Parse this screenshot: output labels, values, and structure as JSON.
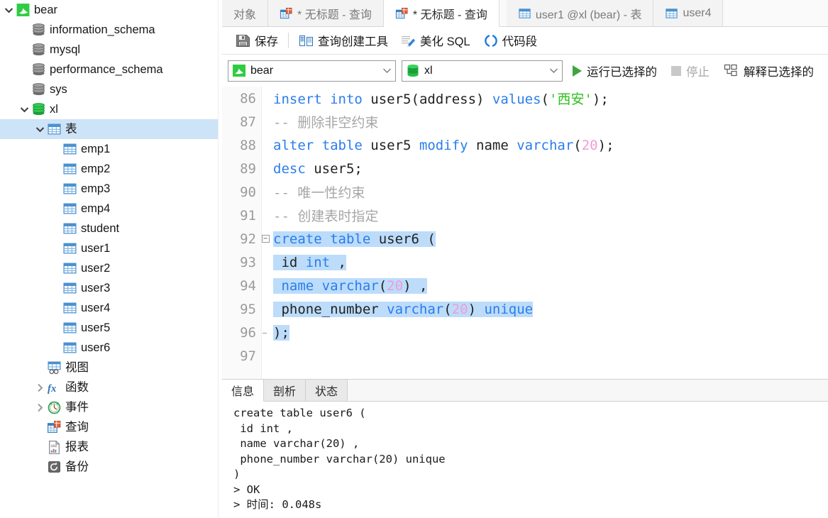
{
  "sidebar": {
    "items": [
      {
        "label": "bear",
        "icon": "navicat-connection-icon",
        "depth": 0,
        "twisty": "down",
        "selected": false
      },
      {
        "label": "information_schema",
        "icon": "database-gray-icon",
        "depth": 1,
        "twisty": "none",
        "selected": false
      },
      {
        "label": "mysql",
        "icon": "database-gray-icon",
        "depth": 1,
        "twisty": "none",
        "selected": false
      },
      {
        "label": "performance_schema",
        "icon": "database-gray-icon",
        "depth": 1,
        "twisty": "none",
        "selected": false
      },
      {
        "label": "sys",
        "icon": "database-gray-icon",
        "depth": 1,
        "twisty": "none",
        "selected": false
      },
      {
        "label": "xl",
        "icon": "database-green-icon",
        "depth": 1,
        "twisty": "down",
        "selected": false
      },
      {
        "label": "表",
        "icon": "table-folder-icon",
        "depth": 2,
        "twisty": "down",
        "selected": true
      },
      {
        "label": "emp1",
        "icon": "table-icon",
        "depth": 3,
        "twisty": "none",
        "selected": false
      },
      {
        "label": "emp2",
        "icon": "table-icon",
        "depth": 3,
        "twisty": "none",
        "selected": false
      },
      {
        "label": "emp3",
        "icon": "table-icon",
        "depth": 3,
        "twisty": "none",
        "selected": false
      },
      {
        "label": "emp4",
        "icon": "table-icon",
        "depth": 3,
        "twisty": "none",
        "selected": false
      },
      {
        "label": "student",
        "icon": "table-icon",
        "depth": 3,
        "twisty": "none",
        "selected": false
      },
      {
        "label": "user1",
        "icon": "table-icon",
        "depth": 3,
        "twisty": "none",
        "selected": false
      },
      {
        "label": "user2",
        "icon": "table-icon",
        "depth": 3,
        "twisty": "none",
        "selected": false
      },
      {
        "label": "user3",
        "icon": "table-icon",
        "depth": 3,
        "twisty": "none",
        "selected": false
      },
      {
        "label": "user4",
        "icon": "table-icon",
        "depth": 3,
        "twisty": "none",
        "selected": false
      },
      {
        "label": "user5",
        "icon": "table-icon",
        "depth": 3,
        "twisty": "none",
        "selected": false
      },
      {
        "label": "user6",
        "icon": "table-icon",
        "depth": 3,
        "twisty": "none",
        "selected": false
      },
      {
        "label": "视图",
        "icon": "view-icon",
        "depth": 2,
        "twisty": "none",
        "selected": false
      },
      {
        "label": "函数",
        "icon": "function-fx-icon",
        "depth": 2,
        "twisty": "right",
        "selected": false
      },
      {
        "label": "事件",
        "icon": "event-clock-icon",
        "depth": 2,
        "twisty": "right",
        "selected": false
      },
      {
        "label": "查询",
        "icon": "query-icon",
        "depth": 2,
        "twisty": "none",
        "selected": false
      },
      {
        "label": "报表",
        "icon": "report-icon",
        "depth": 2,
        "twisty": "none",
        "selected": false
      },
      {
        "label": "备份",
        "icon": "backup-icon",
        "depth": 2,
        "twisty": "none",
        "selected": false
      }
    ]
  },
  "tabs": [
    {
      "label": "对象",
      "icon": "none",
      "active": false,
      "modified": false
    },
    {
      "label": "* 无标题 - 查询",
      "icon": "query-icon",
      "active": false,
      "modified": true
    },
    {
      "label": "* 无标题 - 查询",
      "icon": "query-icon",
      "active": true,
      "modified": true
    },
    {
      "label": "user1 @xl (bear) - 表",
      "icon": "table-icon",
      "active": false,
      "modified": false
    },
    {
      "label": "user4",
      "icon": "table-icon",
      "active": false,
      "modified": false
    }
  ],
  "toolbar": {
    "save_label": "保存",
    "query_builder_label": "查询创建工具",
    "beautify_sql_label": "美化 SQL",
    "code_snippet_label": "代码段"
  },
  "connbar": {
    "connection_value": "bear",
    "database_value": "xl",
    "run_selected_label": "运行已选择的",
    "stop_label": "停止",
    "explain_selected_label": "解释已选择的"
  },
  "editor": {
    "first_line_number": 86,
    "lines": [
      {
        "n": 86,
        "fold": "none",
        "tokens": [
          {
            "t": "insert into ",
            "c": "k"
          },
          {
            "t": "user5",
            "c": "id"
          },
          {
            "t": "(",
            "c": "pn"
          },
          {
            "t": "address",
            "c": "id"
          },
          {
            "t": ") ",
            "c": "pn"
          },
          {
            "t": "values",
            "c": "k"
          },
          {
            "t": "(",
            "c": "pn"
          },
          {
            "t": "'西安'",
            "c": "str"
          },
          {
            "t": ");",
            "c": "pn"
          }
        ],
        "selected": false
      },
      {
        "n": 87,
        "fold": "none",
        "tokens": [
          {
            "t": "-- 删除非空约束",
            "c": "cm"
          }
        ],
        "selected": false
      },
      {
        "n": 88,
        "fold": "none",
        "tokens": [
          {
            "t": "alter table ",
            "c": "k"
          },
          {
            "t": "user5 ",
            "c": "id"
          },
          {
            "t": "modify ",
            "c": "k"
          },
          {
            "t": "name ",
            "c": "id"
          },
          {
            "t": "varchar",
            "c": "k"
          },
          {
            "t": "(",
            "c": "pn"
          },
          {
            "t": "20",
            "c": "num"
          },
          {
            "t": ");",
            "c": "pn"
          }
        ],
        "selected": false
      },
      {
        "n": 89,
        "fold": "none",
        "tokens": [
          {
            "t": "desc ",
            "c": "k"
          },
          {
            "t": "user5;",
            "c": "id"
          }
        ],
        "selected": false
      },
      {
        "n": 90,
        "fold": "none",
        "tokens": [
          {
            "t": "-- 唯一性约束",
            "c": "cm"
          }
        ],
        "selected": false
      },
      {
        "n": 91,
        "fold": "none",
        "tokens": [
          {
            "t": "-- 创建表时指定",
            "c": "cm"
          }
        ],
        "selected": false
      },
      {
        "n": 92,
        "fold": "start",
        "tokens": [
          {
            "t": "create table ",
            "c": "k"
          },
          {
            "t": "user6 ",
            "c": "id"
          },
          {
            "t": "(",
            "c": "pn"
          }
        ],
        "selected": true
      },
      {
        "n": 93,
        "fold": "mid",
        "tokens": [
          {
            "t": " id ",
            "c": "id"
          },
          {
            "t": "int",
            "c": "k"
          },
          {
            "t": " ,",
            "c": "pn"
          }
        ],
        "selected": true
      },
      {
        "n": 94,
        "fold": "mid",
        "tokens": [
          {
            "t": " name ",
            "c": "k"
          },
          {
            "t": "varchar",
            "c": "k"
          },
          {
            "t": "(",
            "c": "pn"
          },
          {
            "t": "20",
            "c": "num"
          },
          {
            "t": ") ,",
            "c": "pn"
          }
        ],
        "selected": true
      },
      {
        "n": 95,
        "fold": "mid",
        "tokens": [
          {
            "t": " phone_number ",
            "c": "id"
          },
          {
            "t": "varchar",
            "c": "k"
          },
          {
            "t": "(",
            "c": "pn"
          },
          {
            "t": "20",
            "c": "num"
          },
          {
            "t": ") ",
            "c": "pn"
          },
          {
            "t": "unique",
            "c": "k"
          }
        ],
        "selected": true
      },
      {
        "n": 96,
        "fold": "end",
        "tokens": [
          {
            "t": ");",
            "c": "pn"
          }
        ],
        "selected": true
      },
      {
        "n": 97,
        "fold": "none",
        "tokens": [
          {
            "t": "",
            "c": "pn"
          }
        ],
        "selected": false
      }
    ]
  },
  "bottom": {
    "tabs": [
      {
        "label": "信息",
        "active": true
      },
      {
        "label": "剖析",
        "active": false
      },
      {
        "label": "状态",
        "active": false
      }
    ],
    "output": "create table user6 (\n id int ,\n name varchar(20) ,\n phone_number varchar(20) unique\n)\n> OK\n> 时间: 0.048s"
  },
  "colors": {
    "selection": "#bcdcfa",
    "tree_selection": "#cde3f7",
    "keyword": "#2a7ded",
    "string": "#2dc21e",
    "number": "#f09cd6",
    "comment": "#a6a6a6",
    "run_green": "#3fa63f"
  }
}
